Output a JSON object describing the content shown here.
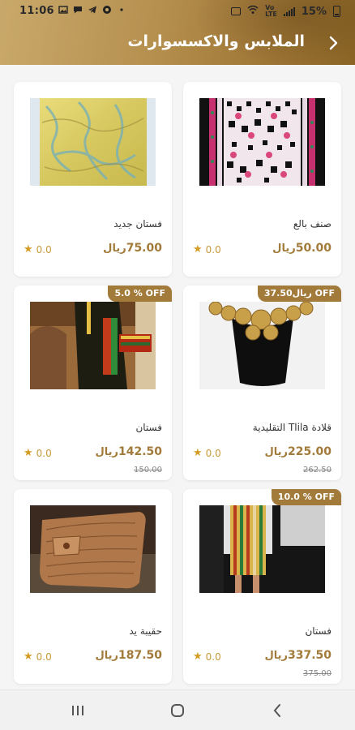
{
  "status_bar": {
    "time": "11:06",
    "battery_percent": "15%",
    "left_icons": [
      "gallery-icon",
      "chat-icon",
      "telegram-icon",
      "game-icon",
      "dot-icon"
    ],
    "right_icons": [
      "alarm-icon",
      "wifi-icon",
      "volte-icon",
      "signal-icon",
      "battery-icon"
    ]
  },
  "header": {
    "title": "الملابس والاكسسوارات",
    "back_icon": "chevron-right-icon",
    "accent": "#a27a3a"
  },
  "products": [
    {
      "name": "صنف بالع",
      "price": "50.00",
      "currency": "ريال",
      "rating": "0.0",
      "old_price": "",
      "discount": "",
      "image": "embroidered-fabric"
    },
    {
      "name": "فستان جديد",
      "price": "75.00",
      "currency": "ريال",
      "rating": "0.0",
      "old_price": "",
      "discount": "",
      "image": "yellow-fabric"
    },
    {
      "name": "قلادة Tlila التقليدية",
      "price": "225.00",
      "currency": "ريال",
      "rating": "0.0",
      "old_price": "262.50",
      "discount": "37.50ريال OFF",
      "image": "gold-necklace"
    },
    {
      "name": "فستان",
      "price": "142.50",
      "currency": "ريال",
      "rating": "0.0",
      "old_price": "150.00",
      "discount": "5.0 % OFF",
      "image": "black-dress"
    },
    {
      "name": "فستان",
      "price": "337.50",
      "currency": "ريال",
      "rating": "0.0",
      "old_price": "375.00",
      "discount": "10.0 % OFF",
      "image": "striped-dress"
    },
    {
      "name": "حقيبة يد",
      "price": "187.50",
      "currency": "ريال",
      "rating": "0.0",
      "old_price": "",
      "discount": "",
      "image": "wooden-handbag"
    }
  ],
  "nav": {
    "recent_icon": "recent-apps-icon",
    "home_icon": "home-icon",
    "back_icon": "back-icon"
  }
}
